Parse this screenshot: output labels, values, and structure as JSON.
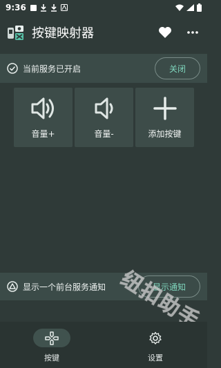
{
  "status_bar": {
    "time": "9:36"
  },
  "app_bar": {
    "title": "按键映射器",
    "icons": [
      "app-logo",
      "heart-icon",
      "more-icon"
    ]
  },
  "service": {
    "status_text": "当前服务已开启",
    "close_label": "关闭",
    "icon": "check-circle-icon"
  },
  "tiles": [
    {
      "label": "音量+",
      "icon": "volume-up-icon"
    },
    {
      "label": "音量-",
      "icon": "volume-down-icon"
    },
    {
      "label": "添加按键",
      "icon": "plus-icon"
    }
  ],
  "notify": {
    "text": "显示一个前台服务通知",
    "button_label": "显示通知",
    "icon": "warning-circle-icon"
  },
  "bottom_nav": {
    "items": [
      {
        "label": "按键",
        "icon": "gamepad-icon",
        "active": true
      },
      {
        "label": "设置",
        "icon": "gear-icon",
        "active": false
      }
    ]
  },
  "watermark": "纽扣助手",
  "colors": {
    "background": "#2f3a38",
    "card": "#3b4b48",
    "tile": "#3d4c49",
    "accent": "#7fd6bd"
  }
}
